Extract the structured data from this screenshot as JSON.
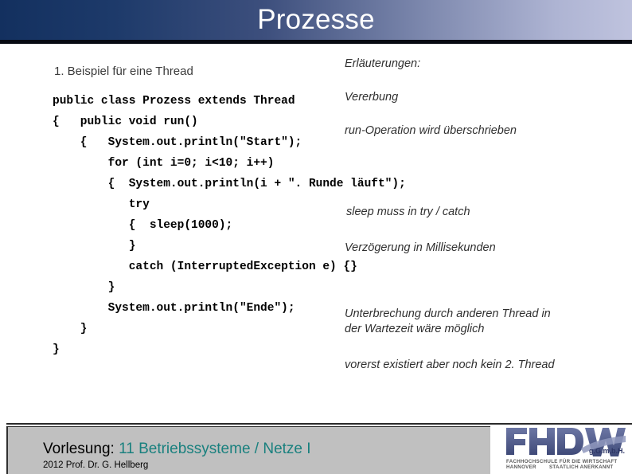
{
  "slide": {
    "title": "Prozesse"
  },
  "content": {
    "heading": "1. Beispiel für eine Thread",
    "code_lines": [
      "public class Prozess extends Thread",
      "{   public void run()",
      "    {   System.out.println(\"Start\");",
      "        for (int i=0; i<10; i++)",
      "        {  System.out.println(i + \". Runde läuft\");",
      "           try",
      "           {  sleep(1000);",
      "           }",
      "           catch (InterruptedException e) {}",
      "        }",
      "        System.out.println(\"Ende\");",
      "    }",
      "}"
    ],
    "notes_title": "Erläuterungen:",
    "notes": [
      "Vererbung",
      "run-Operation wird überschrieben",
      "sleep muss in try / catch",
      "Verzögerung in Millisekunden",
      "Unterbrechung durch anderen Thread in",
      "der Wartezeit wäre möglich",
      "vorerst existiert aber noch kein 2. Thread"
    ]
  },
  "footer": {
    "course_prefix": "Vorlesung: ",
    "course_name": "11 Betriebssysteme / Netze I",
    "author": "2012 Prof. Dr. G. Hellberg",
    "accent_color": "#19807e"
  },
  "logo": {
    "wordmark": "FHDW",
    "suffix": "g.G.m.b.H.",
    "line1": "FACHHOCHSCHULE FÜR DIE WIRTSCHAFT",
    "line2a": "HANNOVER",
    "line2b": "STAATLICH ANERKANNT"
  }
}
